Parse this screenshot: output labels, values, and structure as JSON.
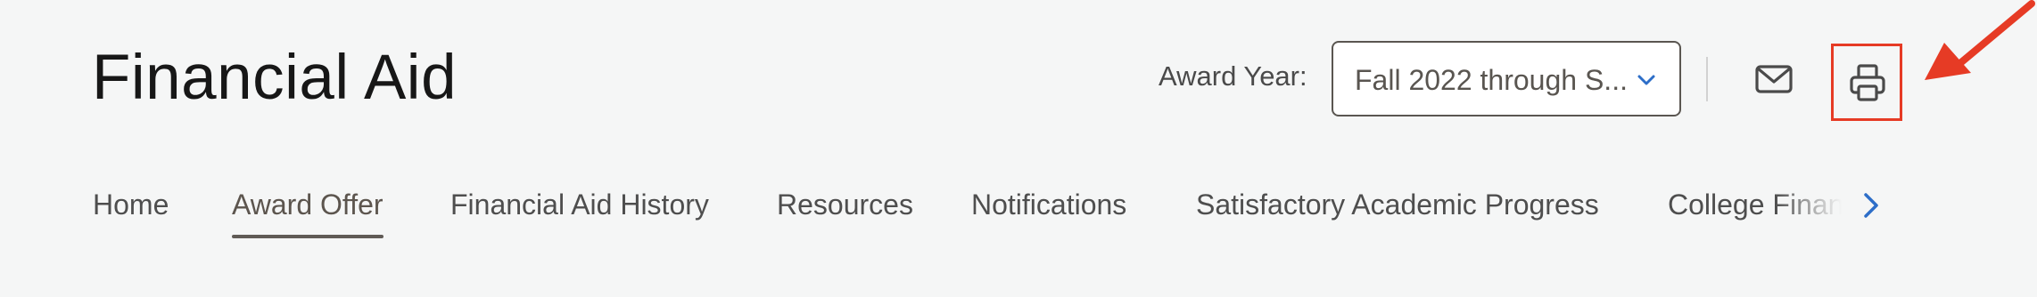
{
  "header": {
    "title": "Financial Aid"
  },
  "award_year": {
    "label": "Award Year:",
    "selected_value": "Fall 2022 through S..."
  },
  "actions": {
    "email_icon": "envelope-icon",
    "print_icon": "printer-icon"
  },
  "nav": {
    "tabs": [
      {
        "label": "Home"
      },
      {
        "label": "Award Offer",
        "active": true
      },
      {
        "label": "Financial Aid History"
      },
      {
        "label": "Resources"
      },
      {
        "label": "Notifications"
      },
      {
        "label": "Satisfactory Academic Progress"
      },
      {
        "label": "College Financ"
      }
    ],
    "next_icon": "chevron-right-icon"
  },
  "colors": {
    "background": "#f5f6f6",
    "accent_blue": "#2d6ec8",
    "highlight_red": "#e63b25",
    "active_underline": "#605b56"
  }
}
